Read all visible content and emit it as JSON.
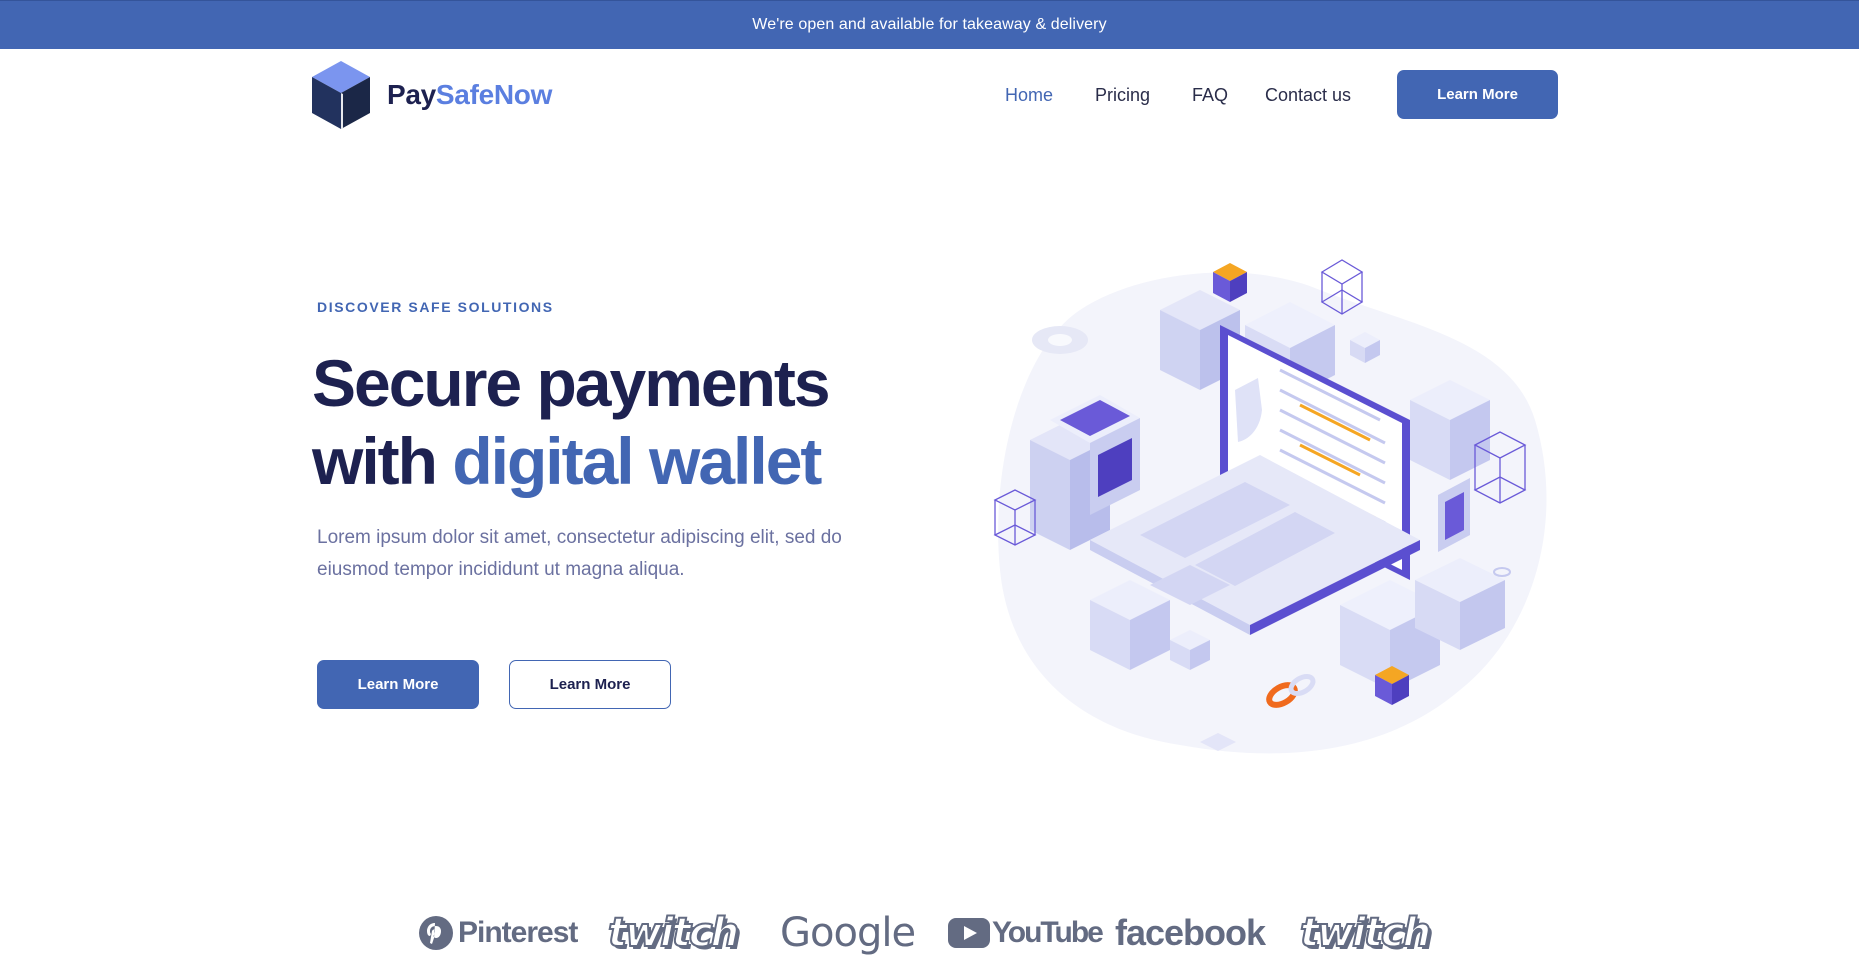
{
  "announcement": "We're open and available for takeaway & delivery",
  "brand": {
    "name_part1": "Pay",
    "name_part2": "SafeNow",
    "logo_icon": "cube-icon"
  },
  "nav": {
    "items": [
      {
        "label": "Home",
        "active": true
      },
      {
        "label": "Pricing",
        "active": false
      },
      {
        "label": "FAQ",
        "active": false
      },
      {
        "label": "Contact us",
        "active": false
      }
    ],
    "cta_label": "Learn More"
  },
  "hero": {
    "eyebrow": "DISCOVER SAFE SOLUTIONS",
    "title_line1": "Secure payments",
    "title_line2_plain": "with ",
    "title_line2_accent": "digital wallet",
    "lead_line1": "Lorem ipsum dolor sit amet, consectetur adipiscing elit, sed do",
    "lead_line2": "eiusmod tempor incididunt ut magna aliqua.",
    "primary_button": "Learn More",
    "secondary_button": "Learn More",
    "illustration": "isometric-laptop-security-illustration"
  },
  "brands": [
    {
      "name": "Pinterest",
      "icon": "pinterest-icon"
    },
    {
      "name": "twitch",
      "icon": "twitch-logo"
    },
    {
      "name": "Google",
      "icon": "google-logo"
    },
    {
      "name": "YouTube",
      "icon": "youtube-icon"
    },
    {
      "name": "facebook",
      "icon": "facebook-logo"
    },
    {
      "name": "twitch",
      "icon": "twitch-logo"
    }
  ],
  "colors": {
    "primary": "#4266b3",
    "dark_navy": "#1d2150",
    "logo_accent": "#5b7fe0",
    "muted_text": "#6b71a0",
    "brand_gray": "#636b82",
    "orange_accent": "#f5a623"
  }
}
